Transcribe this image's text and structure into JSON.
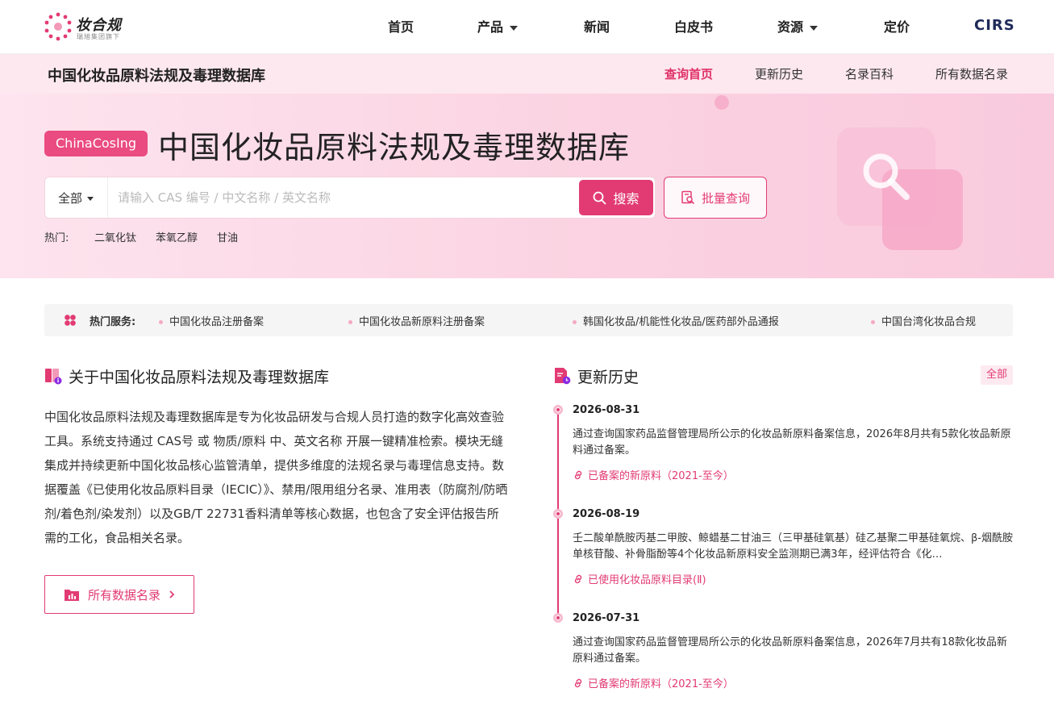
{
  "nav": {
    "brand": "妆合规",
    "brand_sub": "瑞旭集团旗下",
    "items": [
      {
        "label": "首页"
      },
      {
        "label": "产品"
      },
      {
        "label": "新闻"
      },
      {
        "label": "白皮书"
      },
      {
        "label": "资源"
      },
      {
        "label": "定价"
      }
    ],
    "partner": "CIRS"
  },
  "subnav": {
    "title": "中国化妆品原料法规及毒理数据库",
    "links": [
      "查询首页",
      "更新历史",
      "名录百科",
      "所有数据名录"
    ],
    "active": "查询首页"
  },
  "hero": {
    "badge": "ChinaCosIng",
    "title": "中国化妆品原料法规及毒理数据库",
    "scope": "全部",
    "placeholder": "请输入 CAS 编号 / 中文名称 / 英文名称",
    "search_label": "搜索",
    "batch_label": "批量查询",
    "hot_label": "热门:",
    "hot_tags": [
      "二氧化钛",
      "苯氧乙醇",
      "甘油"
    ]
  },
  "services": {
    "label": "热门服务:",
    "items": [
      "中国化妆品注册备案",
      "中国化妆品新原料注册备案",
      "韩国化妆品/机能性化妆品/医药部外品通报",
      "中国台湾化妆品合规"
    ]
  },
  "about": {
    "title": "关于中国化妆品原料法规及毒理数据库",
    "text": "中国化妆品原料法规及毒理数据库是专为化妆品研发与合规人员打造的数字化高效查验工具。系统支持通过 CAS号 或 物质/原料 中、英文名称 开展一键精准检索。模块无缝集成并持续更新中国化妆品核心监管清单，提供多维度的法规名录与毒理信息支持。数据覆盖《已使用化妆品原料目录（IECIC）》、禁用/限用组分名录、准用表（防腐剂/防晒剂/着色剂/染发剂）以及GB/T 22731香料清单等核心数据，也包含了安全评估报告所需的工化，食品相关名录。",
    "button": "所有数据名录"
  },
  "history": {
    "title": "更新历史",
    "all": "全部",
    "entries": [
      {
        "date": "2026-08-31",
        "desc": "通过查询国家药品监督管理局所公示的化妆品新原料备案信息，2026年8月共有5款化妆品新原料通过备案。",
        "link": "已备案的新原料（2021-至今）"
      },
      {
        "date": "2026-08-19",
        "desc": "壬二酸单酰胺丙基二甲胺、鲸蜡基二甘油三（三甲基硅氧基）硅乙基聚二甲基硅氧烷、β-烟酰胺单核苷酸、补骨脂酚等4个化妆品新原料安全监测期已满3年，经评估符合《化…",
        "link": "已使用化妆品原料目录(Ⅱ)"
      },
      {
        "date": "2026-07-31",
        "desc": "通过查询国家药品监督管理局所公示的化妆品新原料备案信息，2026年7月共有18款化妆品新原料通过备案。",
        "link": "已备案的新原料（2021-至今）"
      }
    ]
  },
  "colors": {
    "accent": "#e23b73",
    "hero_bg": "#fbd3e2",
    "subnav_bg": "#fde8ef"
  },
  "icons": [
    "logo-dots-icon",
    "caret-down-icon",
    "search-icon",
    "batch-search-icon",
    "services-flower-icon",
    "book-info-icon",
    "chart-folder-icon",
    "chevron-right-icon",
    "document-clock-icon",
    "link-icon"
  ]
}
